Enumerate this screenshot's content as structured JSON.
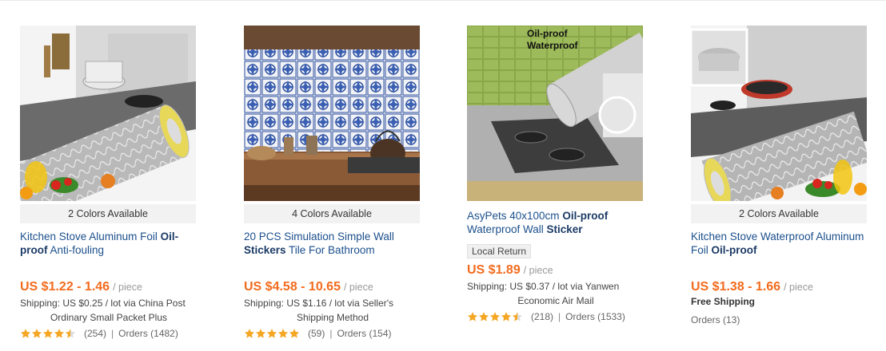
{
  "products": [
    {
      "colors_available": "2 Colors Available",
      "title_pre": "Kitchen Stove Aluminum Foil ",
      "title_bold": "Oil-proof",
      "title_post": " Anti-fouling",
      "price": "US $1.22 - 1.46",
      "unit": "/ piece",
      "shipping_line1": "Shipping: US $0.25 / lot via China Post",
      "shipping_line2": "Ordinary Small Packet Plus",
      "rating_count": "(254)",
      "separator": "|",
      "orders": "Orders (1482)"
    },
    {
      "colors_available": "4 Colors Available",
      "title_pre": "20 PCS Simulation Simple Wall ",
      "title_bold": "Stickers",
      "title_post": " Tile For Bathroom",
      "price": "US $4.58 - 10.65",
      "unit": "/ piece",
      "shipping_line1": "Shipping: US $1.16 / lot via Seller's",
      "shipping_line2": "Shipping Method",
      "rating_count": "(59)",
      "separator": "|",
      "orders": "Orders (154)"
    },
    {
      "image_text_line1": "Oil-proof",
      "image_text_line2": "Waterproof",
      "title_pre": "AsyPets 40x100cm ",
      "title_bold": "Oil-proof",
      "title_mid": " Waterproof Wall ",
      "title_bold2": "Sticker",
      "badge": "Local Return",
      "price": "US $1.89",
      "unit": "/ piece",
      "shipping_line1": "Shipping: US $0.37 / lot via Yanwen",
      "shipping_line2": "Economic Air Mail",
      "rating_count": "(218)",
      "separator": "|",
      "orders": "Orders (1533)"
    },
    {
      "colors_available": "2 Colors Available",
      "title_pre": "Kitchen Stove Waterproof Aluminum Foil ",
      "title_bold": "Oil-proof",
      "price": "US $1.38 - 1.66",
      "unit": "/ piece",
      "free_shipping": "Free Shipping",
      "orders": "Orders (13)"
    }
  ],
  "ratings": [
    4.5,
    5,
    4.5
  ],
  "colors": {
    "price": "#f26b1d",
    "title_link": "#1b4f8c",
    "star": "#f5a623"
  }
}
